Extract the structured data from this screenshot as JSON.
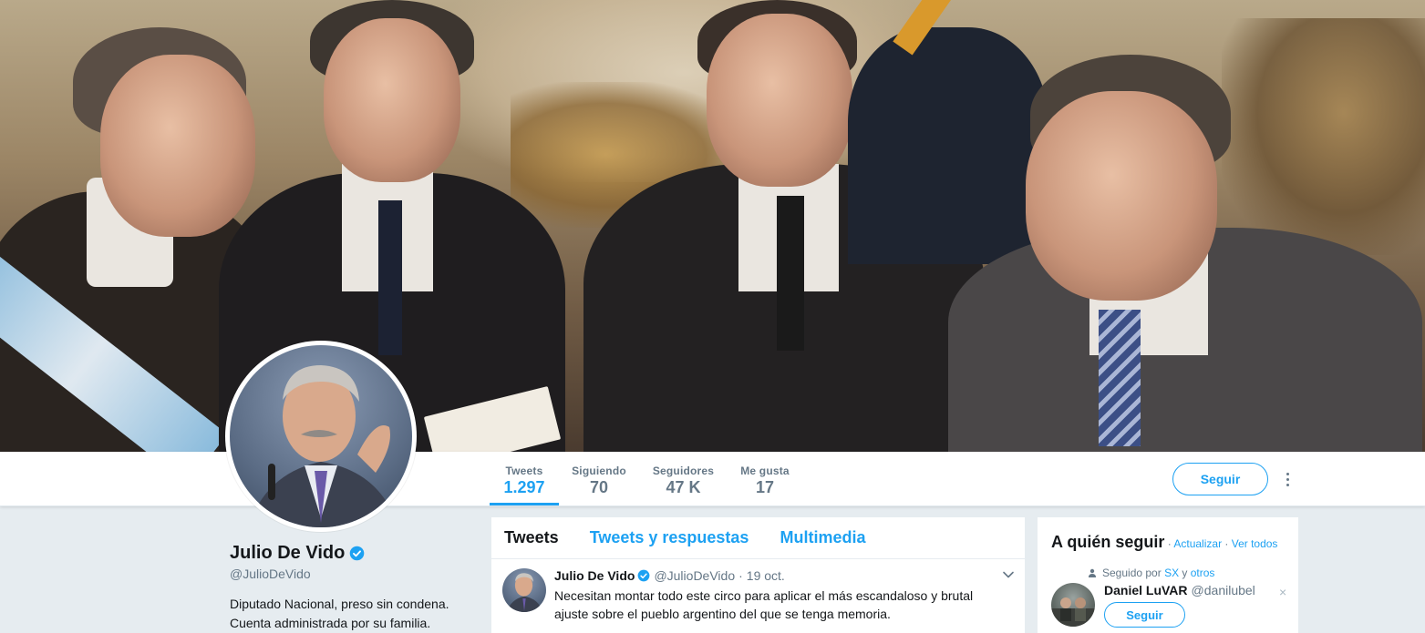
{
  "banner": {
    "description_icon": "profile-header-photo"
  },
  "nav": {
    "stats": [
      {
        "label": "Tweets",
        "value": "1.297"
      },
      {
        "label": "Siguiendo",
        "value": "70"
      },
      {
        "label": "Seguidores",
        "value": "47 K"
      },
      {
        "label": "Me gusta",
        "value": "17"
      }
    ],
    "follow_label": "Seguir"
  },
  "profile": {
    "name": "Julio De Vido",
    "handle": "@JulioDeVido",
    "bio_line1": "Diputado Nacional, preso sin condena.",
    "bio_line2": "Cuenta administrada por su familia."
  },
  "timeline": {
    "tabs": [
      {
        "label": "Tweets"
      },
      {
        "label": "Tweets y respuestas"
      },
      {
        "label": "Multimedia"
      }
    ],
    "tweet": {
      "name": "Julio De Vido",
      "handle": "@JulioDeVido",
      "dot": "·",
      "time": "19 oct.",
      "text_line1": "Necesitan montar todo este circo para aplicar el más escandaloso y brutal",
      "text_line2": "ajuste sobre el pueblo argentino del que se tenga memoria."
    }
  },
  "who_to_follow": {
    "title": "A quién seguir",
    "sep1": " · ",
    "refresh": "Actualizar",
    "sep2": " · ",
    "view_all": "Ver todos",
    "followed_prefix": "Seguido por ",
    "followed_link1": "SX",
    "followed_mid": " y ",
    "followed_link2": "otros",
    "user_name": "Daniel LuVAR",
    "user_handle": "@danilubel",
    "close": "×",
    "follow_label": "Seguir"
  },
  "colors": {
    "accent": "#1da1f2",
    "secondary_text": "#657786",
    "page_bg": "#e6ecf0"
  }
}
